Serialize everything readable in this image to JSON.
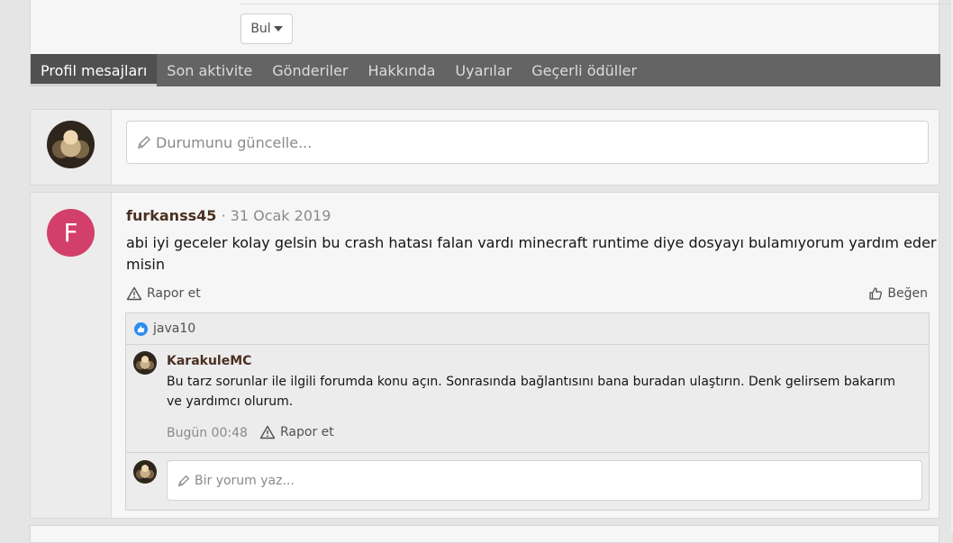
{
  "find_button": {
    "label": "Bul"
  },
  "tabs": [
    {
      "label": "Profil mesajları",
      "active": true
    },
    {
      "label": "Son aktivite",
      "active": false
    },
    {
      "label": "Gönderiler",
      "active": false
    },
    {
      "label": "Hakkında",
      "active": false
    },
    {
      "label": "Uyarılar",
      "active": false
    },
    {
      "label": "Geçerli ödüller",
      "active": false
    }
  ],
  "status": {
    "placeholder": "Durumunu güncelle..."
  },
  "post": {
    "avatar_letter": "F",
    "avatar_color": "#d23f6a",
    "author": "furkanss45",
    "separator": " · ",
    "date": "31 Ocak 2019",
    "text": "abi iyi geceler kolay gelsin bu crash hatası falan vardı minecraft runtime diye dosyayı bulamıyorum yardım eder misin",
    "report_label": "Rapor et",
    "like_label": "Beğen"
  },
  "likes": {
    "user": "java10",
    "icon": "like-icon"
  },
  "comment": {
    "author": "KarakuleMC",
    "text": "Bu tarz sorunlar ile ilgili forumda konu açın. Sonrasında bağlantısını bana buradan ulaştırın. Denk gelirsem bakarım ve yardımcı olurum.",
    "time": "Bugün 00:48",
    "report_label": "Rapor et"
  },
  "reply": {
    "placeholder": "Bir yorum yaz..."
  }
}
